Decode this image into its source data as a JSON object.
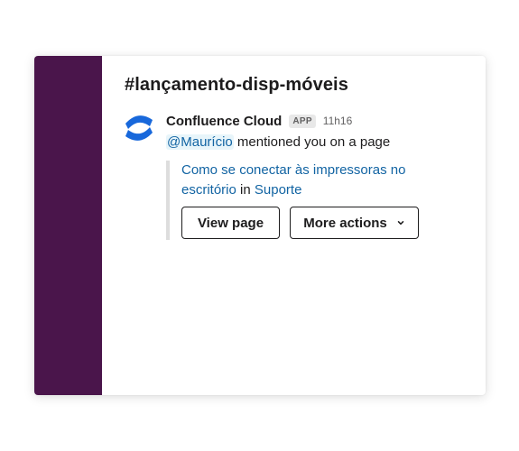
{
  "channel": {
    "title": "#lançamento-disp-móveis"
  },
  "message": {
    "sender": "Confluence Cloud",
    "badge": "APP",
    "time": "11h16",
    "mention": "@Maurício",
    "text": " mentioned you on a page",
    "app_icon": "confluence-logo-icon"
  },
  "attachment": {
    "page_link": "Como se conectar às impressoras no escritório",
    "in_word": " in ",
    "space_link": "Suporte",
    "view_button": "View page",
    "more_button": "More actions",
    "more_icon": "chevron-down-icon"
  },
  "colors": {
    "sidebar": "#4a154b",
    "link": "#1264a3",
    "logo": "#1868db",
    "mention_bg": "#e8f5fa"
  }
}
